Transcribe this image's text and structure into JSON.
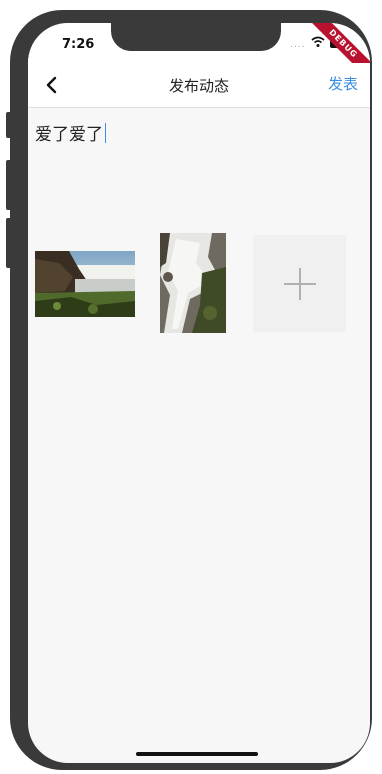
{
  "status_bar": {
    "time": "7:26",
    "signal_text": "....",
    "debug_label": "DEBUG"
  },
  "nav": {
    "title": "发布动态",
    "publish_label": "发表",
    "back_icon": "chevron-left-icon",
    "accent_color": "#3a8ee6"
  },
  "compose": {
    "text": "爱了爱了"
  },
  "photos": {
    "items": [
      {
        "name": "waterfall-landscape-photo"
      },
      {
        "name": "waterfall-closeup-photo"
      }
    ],
    "add_icon": "plus-icon"
  }
}
